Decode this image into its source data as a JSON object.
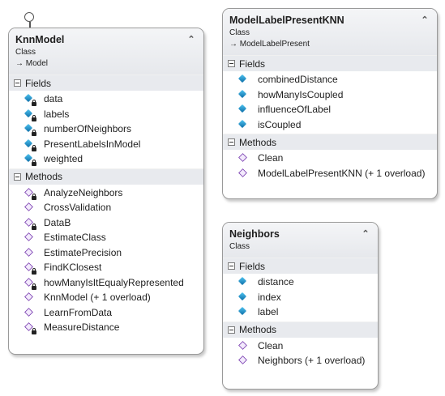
{
  "classes": [
    {
      "name": "KnnModel",
      "kind": "Class",
      "base": "Model",
      "fields_label": "Fields",
      "methods_label": "Methods",
      "fields": [
        {
          "label": "data",
          "private": true
        },
        {
          "label": "labels",
          "private": true
        },
        {
          "label": "numberOfNeighbors",
          "private": true
        },
        {
          "label": "PresentLabelsInModel",
          "private": true
        },
        {
          "label": "weighted",
          "private": true
        }
      ],
      "methods": [
        {
          "label": "AnalyzeNeighbors",
          "private": true
        },
        {
          "label": "CrossValidation",
          "private": false
        },
        {
          "label": "DataB",
          "private": true
        },
        {
          "label": "EstimateClass",
          "private": false
        },
        {
          "label": "EstimatePrecision",
          "private": false
        },
        {
          "label": "FindKClosest",
          "private": true
        },
        {
          "label": "howManyIsItEqualyRepresented",
          "private": true
        },
        {
          "label": "KnnModel (+ 1 overload)",
          "private": false
        },
        {
          "label": "LearnFromData",
          "private": false
        },
        {
          "label": "MeasureDistance",
          "private": true
        }
      ]
    },
    {
      "name": "ModelLabelPresentKNN",
      "kind": "Class",
      "base": "ModelLabelPresent",
      "fields_label": "Fields",
      "methods_label": "Methods",
      "fields": [
        {
          "label": "combinedDistance",
          "private": false
        },
        {
          "label": "howManyIsCoupled",
          "private": false
        },
        {
          "label": "influenceOfLabel",
          "private": false
        },
        {
          "label": "isCoupled",
          "private": false
        }
      ],
      "methods": [
        {
          "label": "Clean",
          "private": false
        },
        {
          "label": "ModelLabelPresentKNN (+ 1 overload)",
          "private": false
        }
      ]
    },
    {
      "name": "Neighbors",
      "kind": "Class",
      "base": "",
      "fields_label": "Fields",
      "methods_label": "Methods",
      "fields": [
        {
          "label": "distance",
          "private": false
        },
        {
          "label": "index",
          "private": false
        },
        {
          "label": "label",
          "private": false
        }
      ],
      "methods": [
        {
          "label": "Clean",
          "private": false
        },
        {
          "label": "Neighbors (+ 1 overload)",
          "private": false
        }
      ]
    }
  ],
  "icons": {
    "field": "field-icon",
    "method": "method-icon",
    "private": "lock-icon",
    "collapse": "chevron-up-icon",
    "interface": "lollipop-icon",
    "inherit": "arrow-right-icon"
  }
}
